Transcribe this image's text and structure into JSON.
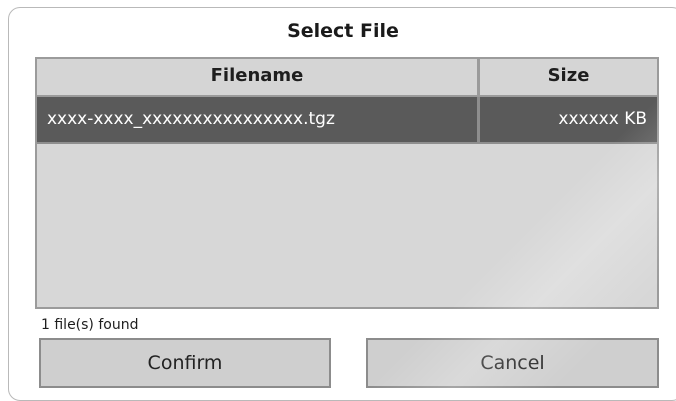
{
  "dialog": {
    "title": "Select File"
  },
  "table": {
    "headers": {
      "filename": "Filename",
      "size": "Size"
    },
    "rows": [
      {
        "filename": "xxxx-xxxx_xxxxxxxxxxxxxxxx.tgz",
        "size": "xxxxxx KB"
      }
    ]
  },
  "status": {
    "text": "1 file(s) found"
  },
  "buttons": {
    "confirm": "Confirm",
    "cancel": "Cancel"
  },
  "colors": {
    "selected_row": "#5a5a5a",
    "panel_background": "#d7d7d7",
    "button_background": "#cfcfcf"
  }
}
